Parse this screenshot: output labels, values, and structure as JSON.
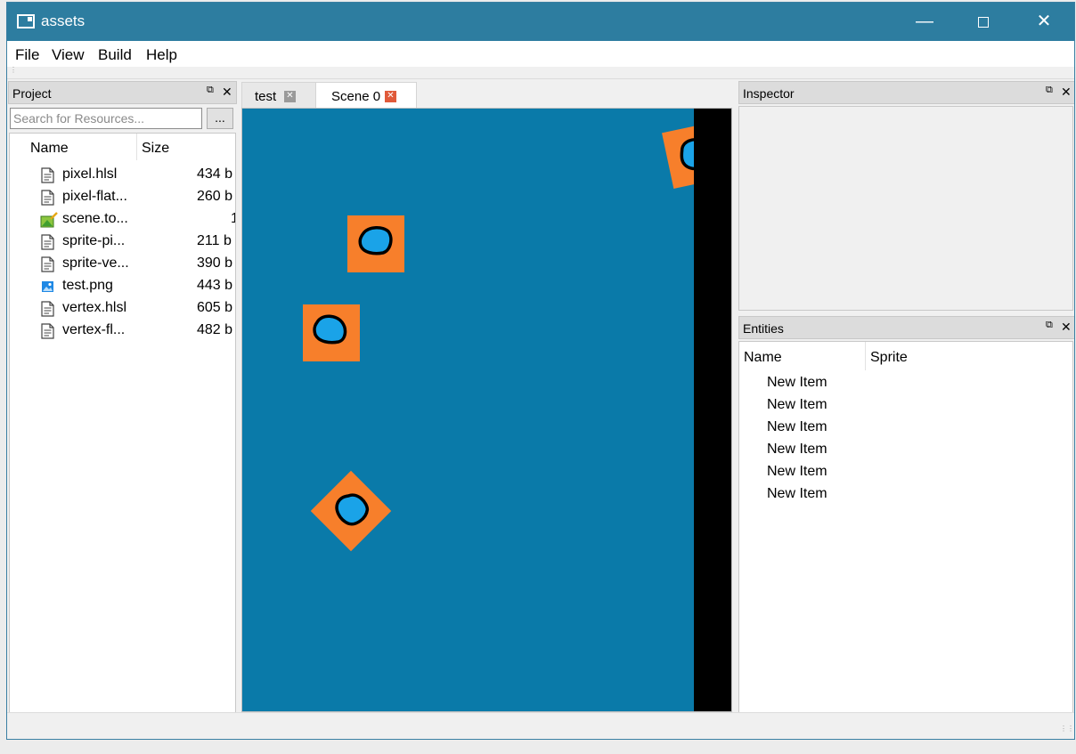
{
  "window": {
    "title": "assets"
  },
  "menu": [
    "File",
    "View",
    "Build",
    "Help"
  ],
  "project": {
    "title": "Project",
    "search_placeholder": "Search for Resources...",
    "browse_label": "...",
    "columns": [
      "Name",
      "Size"
    ],
    "files": [
      {
        "name": "pixel.hlsl",
        "size": "434 b",
        "icon": "text-file-icon"
      },
      {
        "name": "pixel-flat...",
        "size": "260 b",
        "icon": "text-file-icon"
      },
      {
        "name": "scene.to...",
        "size": "1",
        "icon": "scene-file-icon"
      },
      {
        "name": "sprite-pi...",
        "size": "211 b",
        "icon": "text-file-icon"
      },
      {
        "name": "sprite-ve...",
        "size": "390 b",
        "icon": "text-file-icon"
      },
      {
        "name": "test.png",
        "size": "443 b",
        "icon": "image-file-icon"
      },
      {
        "name": "vertex.hlsl",
        "size": "605 b",
        "icon": "text-file-icon"
      },
      {
        "name": "vertex-fl...",
        "size": "482 b",
        "icon": "text-file-icon"
      }
    ]
  },
  "tabs": [
    {
      "label": "test",
      "active": false
    },
    {
      "label": "Scene 0",
      "active": true
    }
  ],
  "inspector": {
    "title": "Inspector"
  },
  "entities": {
    "title": "Entities",
    "columns": [
      "Name",
      "Sprite"
    ],
    "items": [
      "New Item",
      "New Item",
      "New Item",
      "New Item",
      "New Item",
      "New Item"
    ]
  },
  "colors": {
    "titlebar": "#2d7da0",
    "scene_background": "#0a7aa9",
    "sprite_orange": "#f77f2b",
    "sprite_blue": "#1aa3e8",
    "tab_close_active": "#e05a3a"
  }
}
